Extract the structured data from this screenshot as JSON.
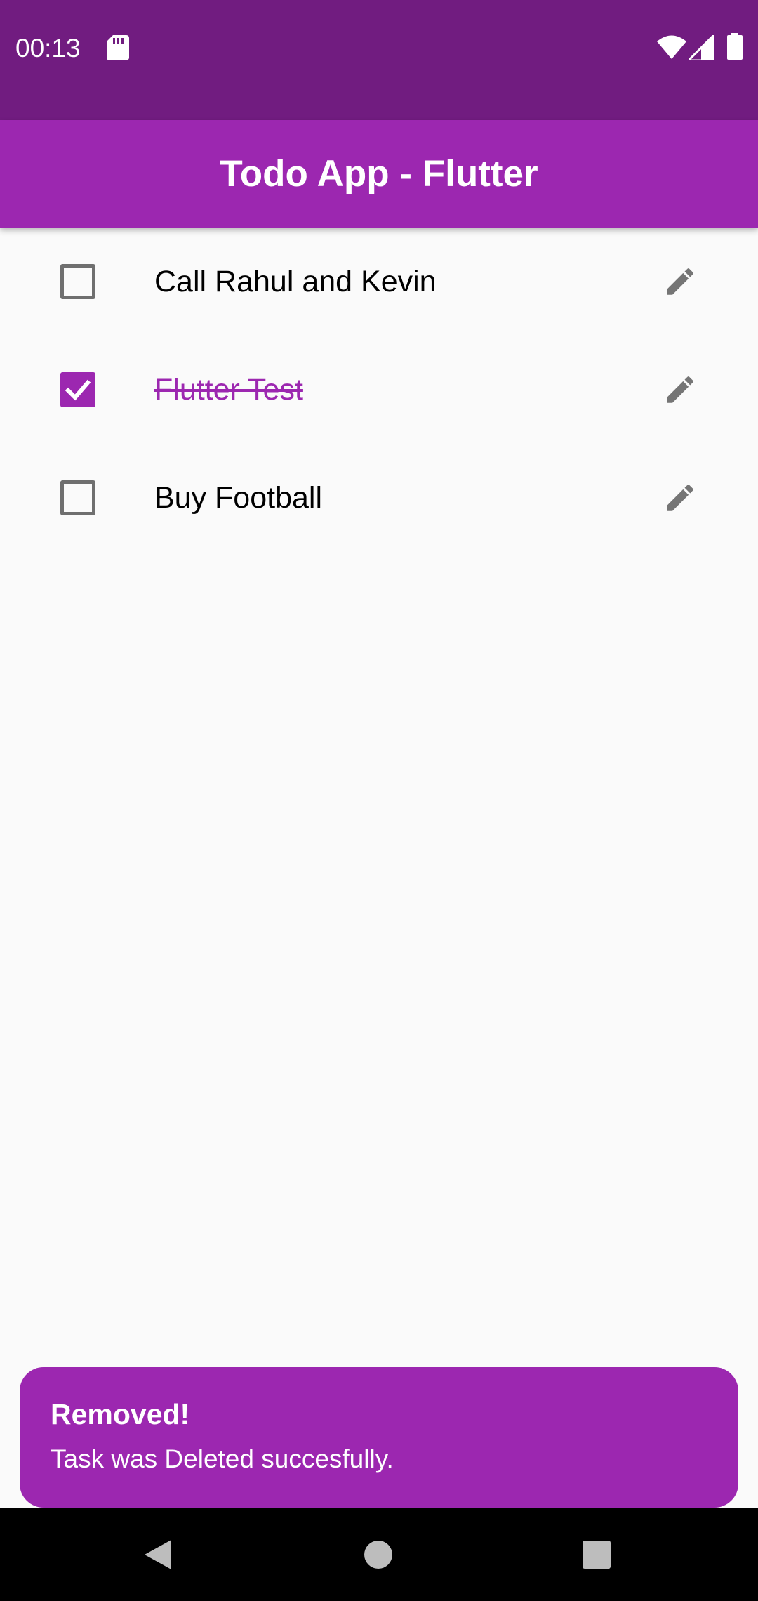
{
  "status_bar": {
    "time": "00:13",
    "icons": [
      "sd-card-icon",
      "wifi-icon",
      "cell-signal-icon",
      "battery-icon"
    ],
    "background": "#711c80"
  },
  "app_bar": {
    "title": "Todo App - Flutter",
    "background": "#9c27b0"
  },
  "todos": [
    {
      "label": "Call Rahul and Kevin",
      "checked": false
    },
    {
      "label": "Flutter Test",
      "checked": true
    },
    {
      "label": "Buy Football",
      "checked": false
    }
  ],
  "snackbar": {
    "title": "Removed!",
    "message": "Task was Deleted succesfully."
  },
  "nav_bar": {
    "buttons": [
      "back-icon",
      "home-icon",
      "recents-icon"
    ]
  },
  "colors": {
    "accent": "#9c27b0",
    "status_bar": "#711c80",
    "icon_grey": "#757575",
    "background": "#fafafa"
  }
}
